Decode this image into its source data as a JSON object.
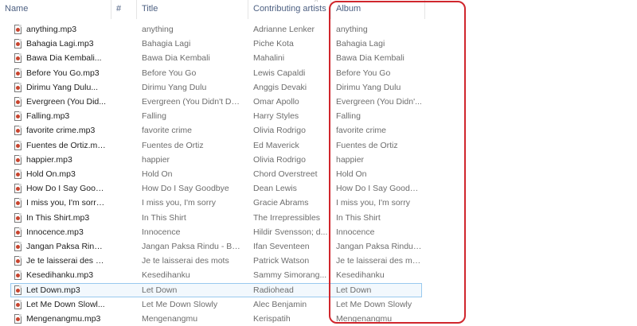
{
  "columns": {
    "name": "Name",
    "number": "#",
    "title": "Title",
    "contributing_artists": "Contributing artists",
    "album": "Album"
  },
  "rows": [
    {
      "name": "anything.mp3",
      "title": "anything",
      "artist": "Adrianne Lenker",
      "album": "anything"
    },
    {
      "name": "Bahagia Lagi.mp3",
      "title": "Bahagia Lagi",
      "artist": "Piche Kota",
      "album": "Bahagia Lagi"
    },
    {
      "name": "Bawa Dia Kembali...",
      "title": "Bawa Dia Kembali",
      "artist": "Mahalini",
      "album": "Bawa Dia Kembali"
    },
    {
      "name": "Before You Go.mp3",
      "title": "Before You Go",
      "artist": "Lewis Capaldi",
      "album": "Before You Go"
    },
    {
      "name": "Dirimu Yang Dulu...",
      "title": "Dirimu Yang Dulu",
      "artist": "Anggis Devaki",
      "album": "Dirimu Yang Dulu"
    },
    {
      "name": "Evergreen (You Did...",
      "title": "Evergreen (You Didn't Des...",
      "artist": "Omar Apollo",
      "album": "Evergreen (You Didn'..."
    },
    {
      "name": "Falling.mp3",
      "title": "Falling",
      "artist": "Harry Styles",
      "album": "Falling"
    },
    {
      "name": "favorite crime.mp3",
      "title": "favorite crime",
      "artist": "Olivia Rodrigo",
      "album": "favorite crime"
    },
    {
      "name": "Fuentes de Ortiz.mp3",
      "title": "Fuentes de Ortiz",
      "artist": "Ed Maverick",
      "album": "Fuentes de Ortiz"
    },
    {
      "name": "happier.mp3",
      "title": "happier",
      "artist": "Olivia Rodrigo",
      "album": "happier"
    },
    {
      "name": "Hold On.mp3",
      "title": "Hold On",
      "artist": "Chord Overstreet",
      "album": "Hold On"
    },
    {
      "name": "How Do I Say Good...",
      "title": "How Do I Say Goodbye",
      "artist": "Dean Lewis",
      "album": "How Do I Say Goodbye"
    },
    {
      "name": "I miss you, I'm sorry...",
      "title": "I miss you, I'm sorry",
      "artist": "Gracie Abrams",
      "album": "I miss you, I'm sorry"
    },
    {
      "name": "In This Shirt.mp3",
      "title": "In This Shirt",
      "artist": "The Irrepressibles",
      "album": "In This Shirt"
    },
    {
      "name": "Innocence.mp3",
      "title": "Innocence",
      "artist": "Hildir Svensson; d...",
      "album": "Innocence"
    },
    {
      "name": "Jangan Paksa Rindu...",
      "title": "Jangan Paksa Rindu - Beda",
      "artist": "Ifan Seventeen",
      "album": "Jangan Paksa Rindu -..."
    },
    {
      "name": "Je te laisserai des m...",
      "title": "Je te laisserai des mots",
      "artist": "Patrick Watson",
      "album": "Je te laisserai des mots"
    },
    {
      "name": "Kesedihanku.mp3",
      "title": "Kesedihanku",
      "artist": "Sammy Simorang...",
      "album": "Kesedihanku"
    },
    {
      "name": "Let Down.mp3",
      "title": "Let Down",
      "artist": "Radiohead",
      "album": "Let Down",
      "selected": true
    },
    {
      "name": "Let Me Down Slowl...",
      "title": "Let Me Down Slowly",
      "artist": "Alec Benjamin",
      "album": "Let Me Down Slowly"
    },
    {
      "name": "Mengenangmu.mp3",
      "title": "Mengenangmu",
      "artist": "Kerispatih",
      "album": "Mengenangmu"
    }
  ],
  "colors": {
    "highlight": "#d0262d",
    "header_text": "#4d6082",
    "selection_border": "#99c9ef",
    "file_icon_accent": "#c8442e"
  }
}
